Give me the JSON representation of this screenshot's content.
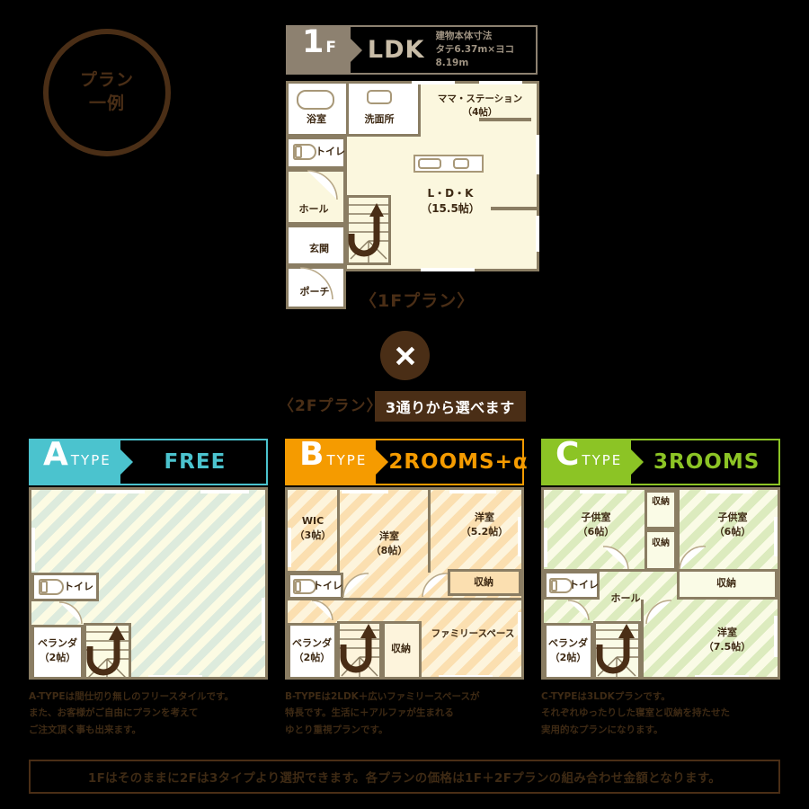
{
  "badge": {
    "line1": "プラン",
    "line2": "一例"
  },
  "floor1": {
    "floor_num": "1",
    "floor_suffix": "F",
    "title": "LDK",
    "dims_line1": "建物本体寸法",
    "dims_line2": "タテ6.37m×ヨコ8.19m",
    "caption": "〈1Fプラン〉",
    "rooms": [
      {
        "name": "浴室"
      },
      {
        "name": "洗面所"
      },
      {
        "name": "ママ・ステーション",
        "size": "（4帖）"
      },
      {
        "name": "トイレ"
      },
      {
        "name": "ホール"
      },
      {
        "name": "玄関"
      },
      {
        "name": "ポーチ"
      },
      {
        "name": "L・D・K",
        "size": "（15.5帖）"
      }
    ]
  },
  "multiply_symbol": "×",
  "floor2": {
    "caption": "〈2Fプラン〉",
    "badge": "3通りから選べます"
  },
  "types": [
    {
      "letter": "A",
      "type_label": "TYPE",
      "value": "FREE",
      "color": "#4BC3CE",
      "description": "A-TYPEは間仕切り無しのフリースタイルです。\nまた、お客様がご自由にプランを考えて\nご注文頂く事も出来ます。",
      "rooms": [
        {
          "name": "トイレ"
        },
        {
          "name": "ベランダ",
          "size": "（2帖）"
        }
      ]
    },
    {
      "letter": "B",
      "type_label": "TYPE",
      "value": "2ROOMS+α",
      "color": "#F59B00",
      "description": "B-TYPEは2LDK＋広いファミリースペースが\n特長です。生活に＋アルファが生まれる\nゆとり重視プランです。",
      "rooms": [
        {
          "name": "WIC",
          "size": "（3帖）"
        },
        {
          "name": "洋室",
          "size": "（8帖）"
        },
        {
          "name": "洋室",
          "size": "（5.2帖）"
        },
        {
          "name": "収納"
        },
        {
          "name": "トイレ"
        },
        {
          "name": "ベランダ",
          "size": "（2帖）"
        },
        {
          "name": "収納"
        },
        {
          "name": "ファミリースペース"
        }
      ]
    },
    {
      "letter": "C",
      "type_label": "TYPE",
      "value": "3ROOMS",
      "color": "#8CC425",
      "description": "C-TYPEは3LDKプランです。\nそれぞれゆったりした寝室と収納を持たせた\n実用的なプランになります。",
      "rooms": [
        {
          "name": "子供室",
          "size": "（6帖）"
        },
        {
          "name": "収納"
        },
        {
          "name": "収納"
        },
        {
          "name": "子供室",
          "size": "（6帖）"
        },
        {
          "name": "トイレ"
        },
        {
          "name": "ホール"
        },
        {
          "name": "収納"
        },
        {
          "name": "ベランダ",
          "size": "（2帖）"
        },
        {
          "name": "洋室",
          "size": "（7.5帖）"
        }
      ]
    }
  ],
  "bottom_banner": "1Fはそのままに2Fは3タイプより選択できます。各プランの価格は1F＋2Fプランの組み合わせ金額となります。"
}
